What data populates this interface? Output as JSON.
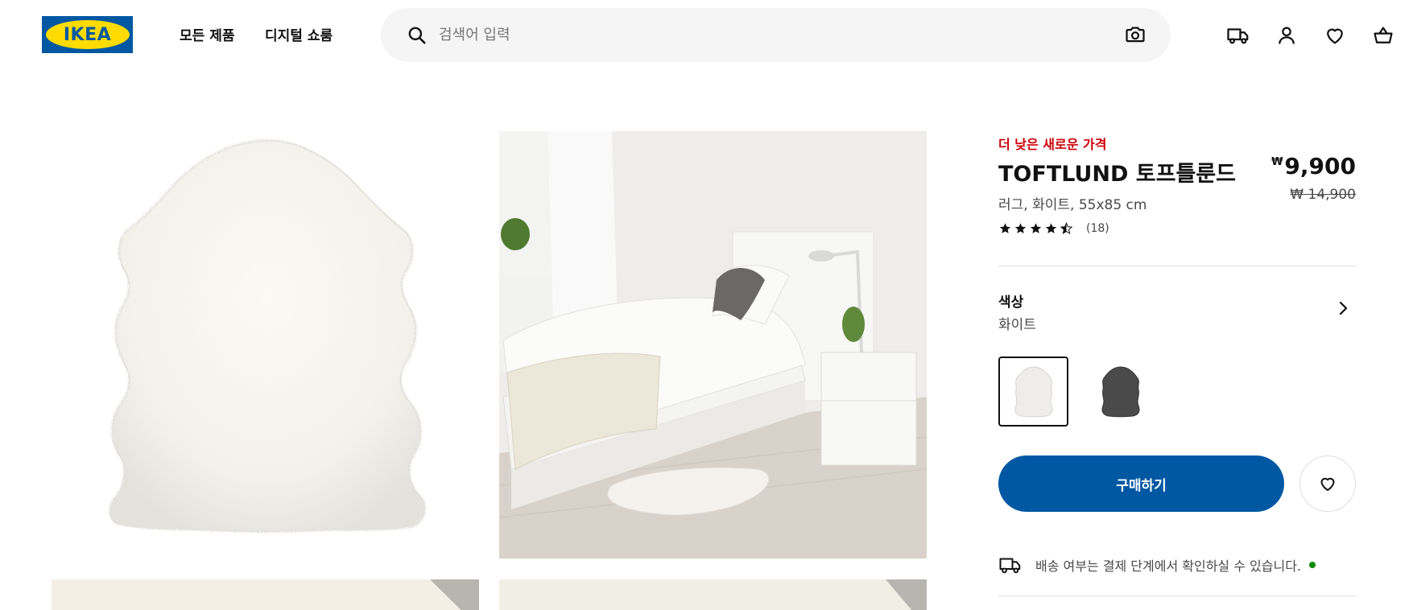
{
  "brand": {
    "logo_text": "IKEA",
    "colors": {
      "blue": "#0058a3",
      "yellow": "#ffdb00",
      "sale_red": "#cc0008"
    }
  },
  "header": {
    "nav": {
      "all_products": "모든 제품",
      "digital_showroom": "디지털 쇼룸"
    },
    "search": {
      "placeholder": "검색어 입력"
    },
    "icons": [
      "search-icon",
      "camera-icon",
      "delivery-truck-icon",
      "user-icon",
      "heart-icon",
      "basket-icon"
    ]
  },
  "product": {
    "price_badge": "더 낮은 새로운 가격",
    "name": "TOFTLUND 토프틀룬드",
    "description": "러그, 화이트, 55x85 cm",
    "price": {
      "currency": "₩",
      "value": "9,900"
    },
    "old_price": "₩ 14,900",
    "rating": {
      "stars": 4.5,
      "max": 5,
      "count_label": "(18)"
    },
    "color": {
      "title": "색상",
      "value": "화이트"
    },
    "swatches": [
      {
        "name": "white",
        "selected": true
      },
      {
        "name": "dark-gray",
        "selected": false
      }
    ],
    "buy_label": "구매하기",
    "delivery_text": "배송 여부는 결제 단계에서 확인하실 수 있습니다."
  }
}
